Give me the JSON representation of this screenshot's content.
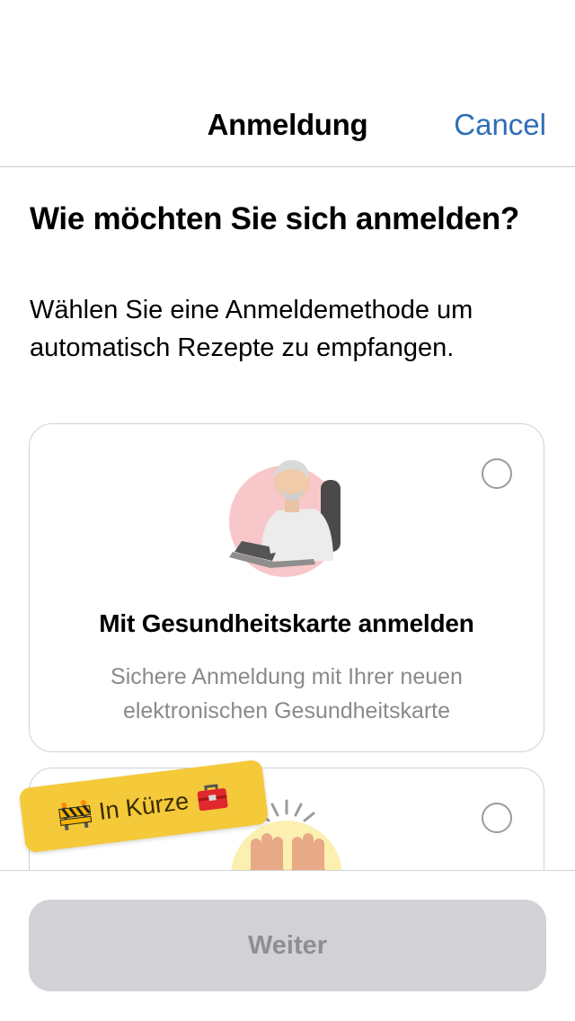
{
  "nav": {
    "title": "Anmeldung",
    "cancel_label": "Cancel"
  },
  "intro": {
    "heading": "Wie möchten Sie sich anmelden?",
    "subtitle": "Wählen Sie eine Anmeldemethode um automatisch Rezepte zu empfangen."
  },
  "options": [
    {
      "title": "Mit Gesundheitskarte anmelden",
      "description": "Sichere Anmeldung mit Ihrer neuen elektronischen Gesundheitskarte",
      "illustration": "person-at-laptop-illustration",
      "selected": false
    },
    {
      "illustration": "raised-hands-illustration",
      "selected": false
    }
  ],
  "badge": {
    "label": "In Kürze",
    "icon_left": "construction-barrier-icon",
    "icon_right": "toolbox-icon",
    "color": "#f4c93a"
  },
  "footer": {
    "continue_label": "Weiter"
  },
  "colors": {
    "accent": "#2f6eb5",
    "disabled_button": "#d1d1d6",
    "muted_text": "#8a8a8e"
  }
}
